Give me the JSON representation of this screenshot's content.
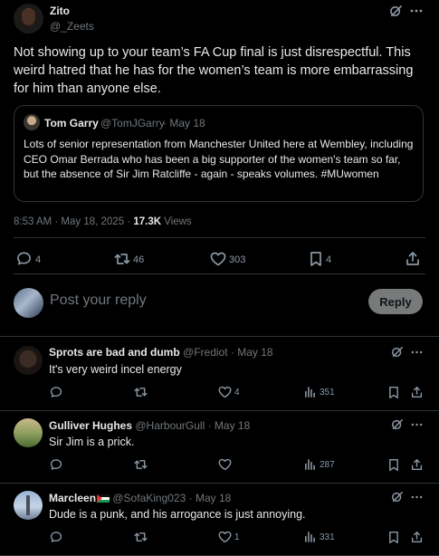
{
  "main_tweet": {
    "display_name": "Zito",
    "handle": "@_Zeets",
    "text": "Not showing up to your team’s FA Cup final is just disrespectful. This weird hatred that he has for the women’s team is more embarrassing for him than anyone else.",
    "quote": {
      "display_name": "Tom Garry",
      "handle": "@TomJGarry",
      "date": "· May 18",
      "text": "Lots of senior representation from Manchester United here at Wembley, including CEO Omar Berrada who has been a big supporter of the women's team so far, but the absence of Sir Jim Ratcliffe - again - speaks volumes. #MUwomen"
    },
    "meta": {
      "timestamp": "8:53 AM · May 18, 2025 · ",
      "views_count": "17.3K",
      "views_label": " Views"
    },
    "stats": {
      "replies": "4",
      "reposts": "46",
      "likes": "303",
      "bookmarks": "4"
    }
  },
  "reply_box": {
    "placeholder": "Post your reply",
    "button_label": "Reply"
  },
  "replies": [
    {
      "display_name": "Sprots are bad and dumb",
      "handle": "@Frediot",
      "date": "· May 18",
      "text": "It's very weird incel energy",
      "likes": "4",
      "views": "351"
    },
    {
      "display_name": "Gulliver Hughes",
      "handle": "@HarbourGull",
      "date": "· May 18",
      "text": "Sir Jim is a prick.",
      "likes": "",
      "views": "287"
    },
    {
      "display_name": "Marcleen",
      "handle": "@SofaKing023",
      "date": "· May 18",
      "text": "Dude is a punk, and his arrogance is just annoying.",
      "likes": "1",
      "views": "331"
    }
  ],
  "colors": {
    "background": "#000000",
    "text": "#e7e9ea",
    "muted": "#71767b",
    "border": "#2f3336",
    "button_bg": "#eff3f4"
  },
  "icons": [
    "grok-icon",
    "more-icon",
    "reply-icon",
    "repost-icon",
    "like-icon",
    "views-icon",
    "bookmark-icon",
    "share-icon",
    "flag-icon"
  ]
}
